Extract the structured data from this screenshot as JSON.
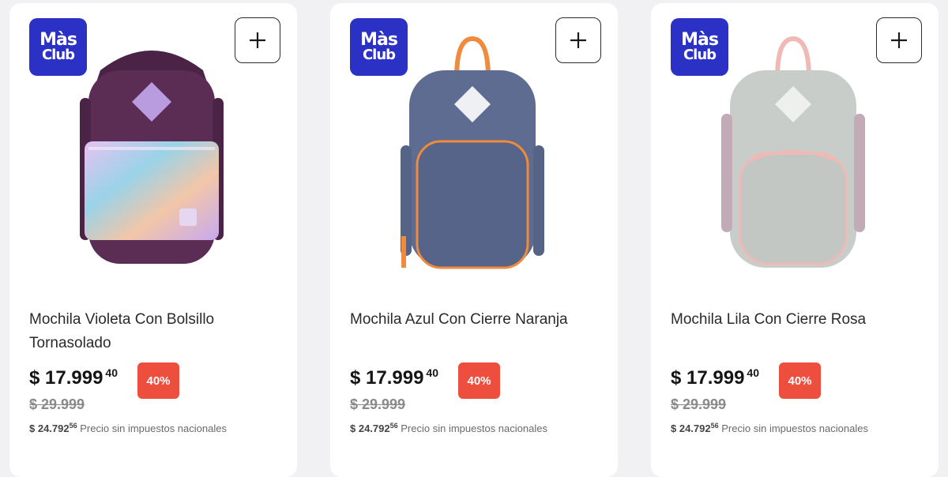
{
  "products": [
    {
      "badge_line1": "Màs",
      "badge_line2": "Club",
      "title": "Mochila Violeta Con Bolsillo Tornasolado",
      "price_main": "$ 17.999",
      "price_cents": "40",
      "discount": "40%",
      "old_price": "$ 29.999",
      "net_amount": "$ 24.792",
      "net_cents": "56",
      "net_label": "Precio sin impuestos nacionales",
      "colors": {
        "body": "#5b2d55",
        "accent": "#c9a7e6"
      }
    },
    {
      "badge_line1": "Màs",
      "badge_line2": "Club",
      "title": "Mochila Azul Con Cierre Naranja",
      "price_main": "$ 17.999",
      "price_cents": "40",
      "discount": "40%",
      "old_price": "$ 29.999",
      "net_amount": "$ 24.792",
      "net_cents": "56",
      "net_label": "Precio sin impuestos nacionales",
      "colors": {
        "body": "#5d6c90",
        "accent": "#f08a3c"
      }
    },
    {
      "badge_line1": "Màs",
      "badge_line2": "Club",
      "title": "Mochila Lila Con Cierre Rosa",
      "price_main": "$ 17.999",
      "price_cents": "40",
      "discount": "40%",
      "old_price": "$ 29.999",
      "net_amount": "$ 24.792",
      "net_cents": "56",
      "net_label": "Precio sin impuestos nacionales",
      "colors": {
        "body": "#c9cdc9",
        "accent": "#f0b9b5"
      }
    }
  ],
  "brand_colors": {
    "badge": "#2b31c4",
    "discount": "#ee4e3d"
  },
  "icons": {
    "add": "plus-icon"
  }
}
